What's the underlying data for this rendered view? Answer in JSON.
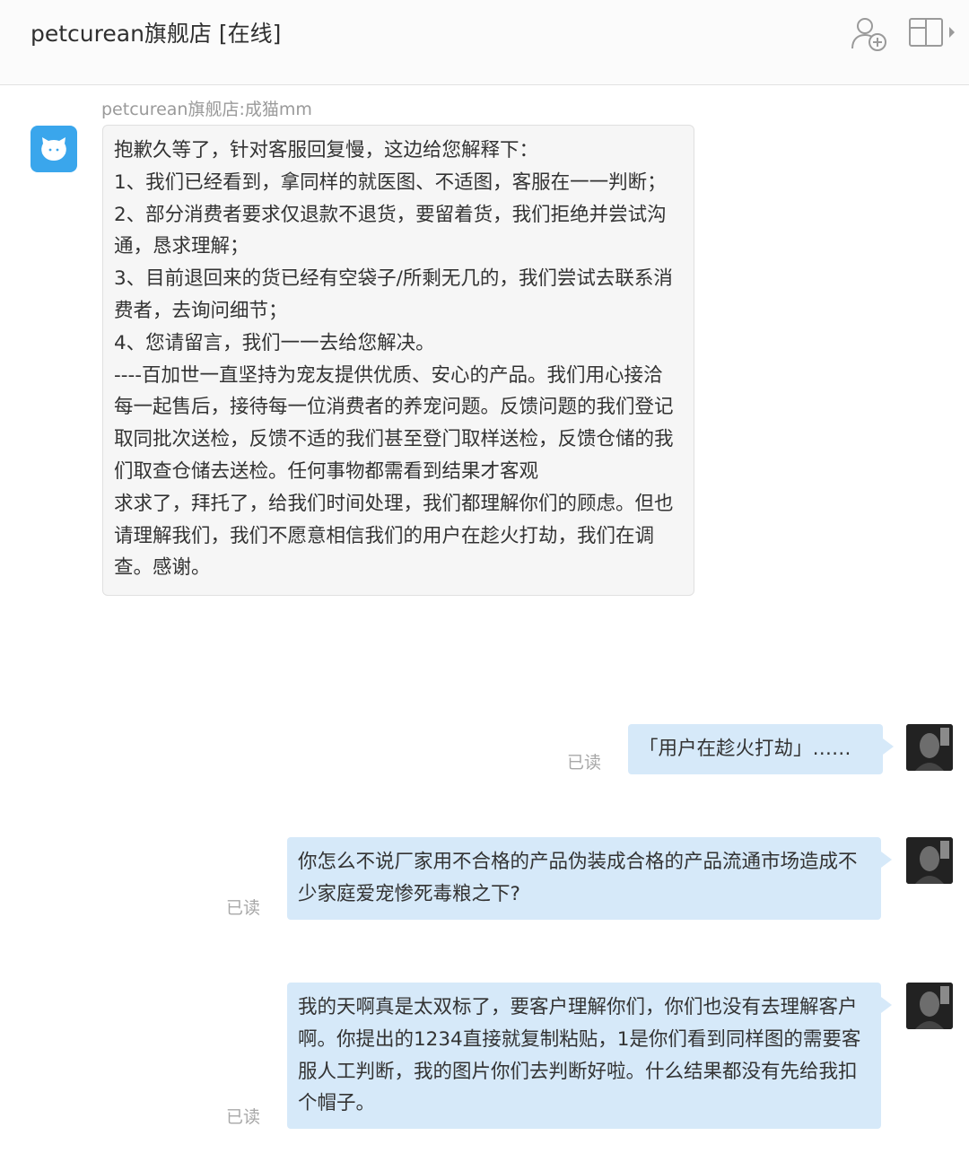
{
  "header": {
    "title": "petcurean旗舰店 [在线]",
    "icons": [
      "add-contact-icon",
      "panel-toggle-icon"
    ]
  },
  "incoming": {
    "sender": "petcurean旗舰店:成猫mm",
    "lines": [
      "抱歉久等了，针对客服回复慢，这边给您解释下：",
      "1、我们已经看到，拿同样的就医图、不适图，客服在一一判断；",
      "2、部分消费者要求仅退款不退货，要留着货，我们拒绝并尝试沟通，恳求理解；",
      "3、目前退回来的货已经有空袋子/所剩无几的，我们尝试去联系消费者，去询问细节；",
      "4、您请留言，我们一一去给您解决。",
      "----百加世一直坚持为宠友提供优质、安心的产品。我们用心接洽每一起售后，接待每一位消费者的养宠问题。反馈问题的我们登记取同批次送检，反馈不适的我们甚至登门取样送检，反馈仓储的我们取查仓储去送检。任何事物都需看到结果才客观",
      "求求了，拜托了，给我们时间处理，我们都理解你们的顾虑。但也请理解我们，我们不愿意相信我们的用户在趁火打劫，我们在调查。感谢。"
    ]
  },
  "outgoing": [
    {
      "status": "已读",
      "lines": [
        "「用户在趁火打劫」……"
      ]
    },
    {
      "status": "已读",
      "lines": [
        "你怎么不说厂家用不合格的产品伪装成合格的产品流通市场造成不少家庭爱宠惨死毒粮之下?"
      ]
    },
    {
      "status": "已读",
      "lines": [
        "我的天啊真是太双标了，要客户理解你们，你们也没有去理解客户啊。你提出的1234直接就复制粘贴，1是你们看到同样图的需要客服人工判断，我的图片你们去判断好啦。什么结果都没有先给我扣个帽子。"
      ]
    }
  ],
  "colors": {
    "outgoing_bubble": "#d6e9f9",
    "incoming_bubble": "#f6f6f6",
    "shop_avatar": "#3aa6ec"
  }
}
